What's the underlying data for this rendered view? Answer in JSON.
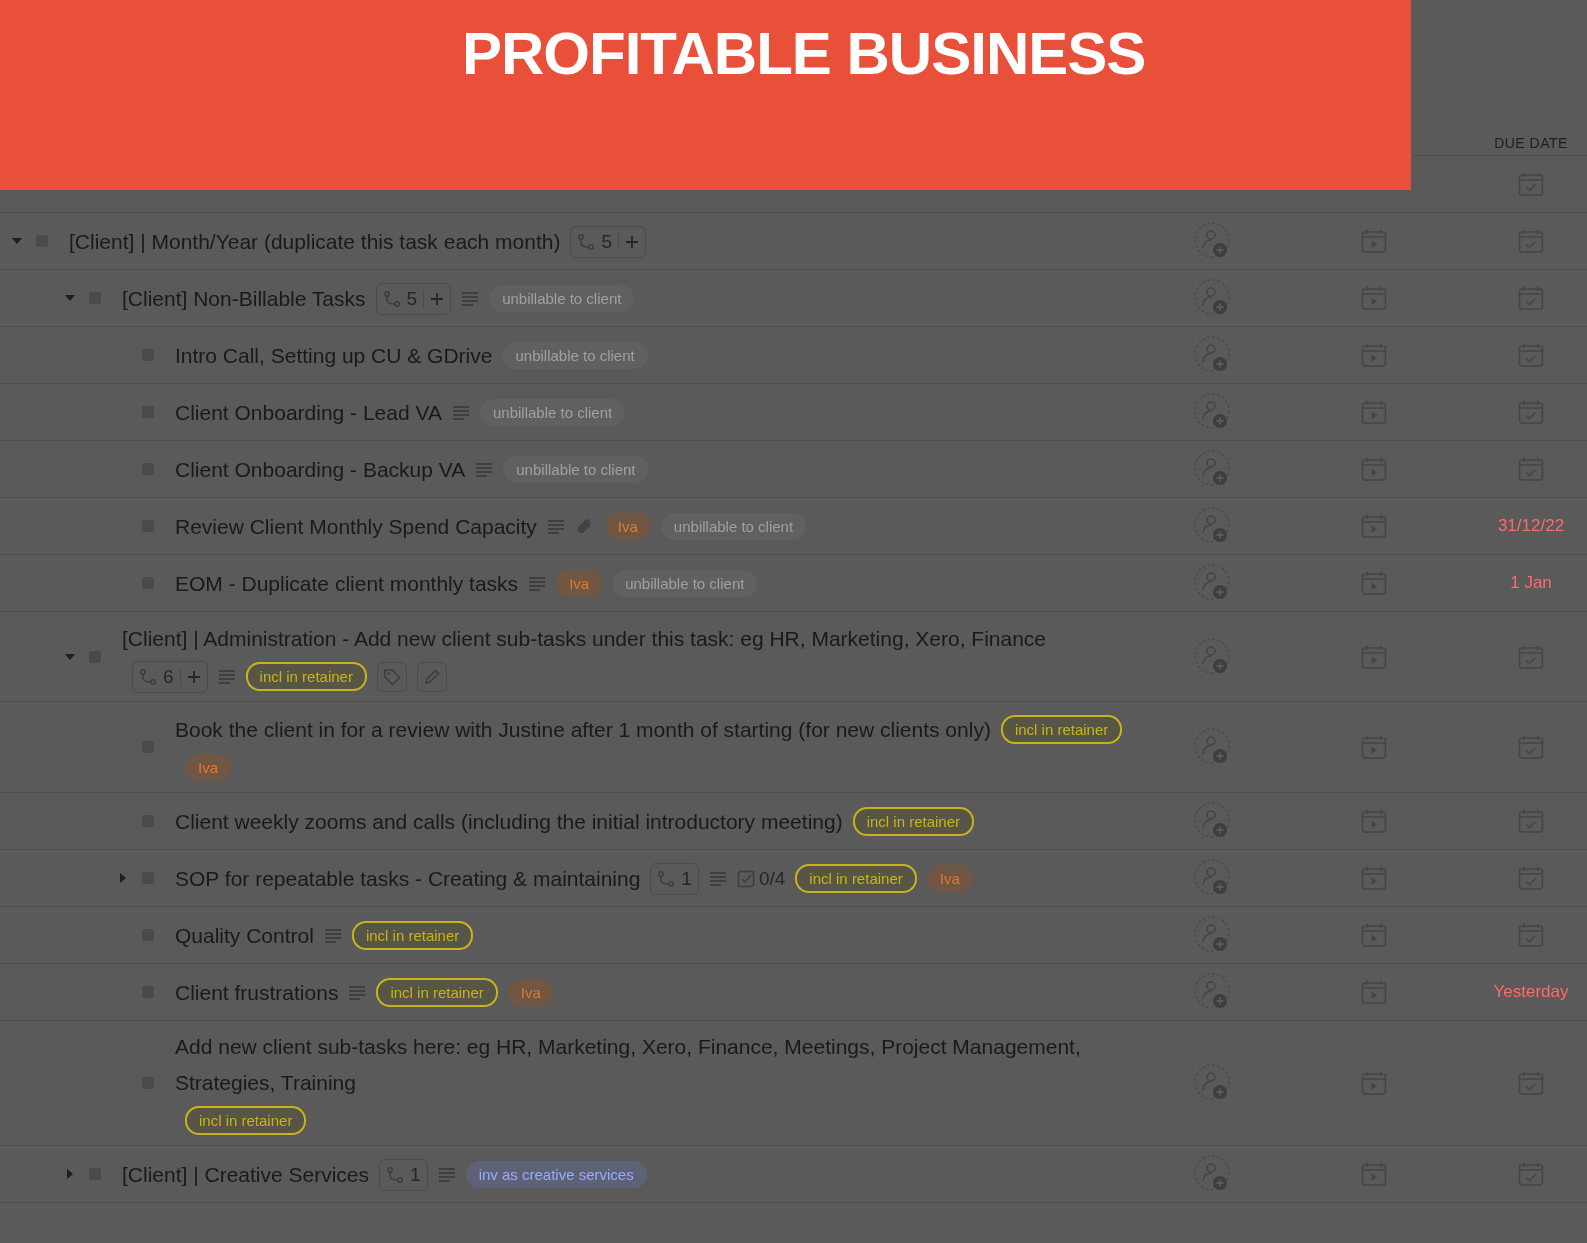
{
  "banner": {
    "title": "PROFITABLE BUSINESS"
  },
  "columns": {
    "due_date": "DUE DATE"
  },
  "tasks": [
    {
      "name": "[Client] | Month/Year (duplicate this task each month)",
      "checked": false,
      "expanded": true,
      "items": [
        {
          "kind": "subtasks",
          "count": "5"
        }
      ],
      "children": [
        {
          "name": "[Client] Non-Billable Tasks",
          "checked": false,
          "expanded": true,
          "items": [
            {
              "kind": "subtasks",
              "count": "5"
            },
            {
              "kind": "description"
            },
            {
              "kind": "tag",
              "label": "unbillable to client",
              "color": "#a0a0a0"
            }
          ],
          "children": [
            {
              "name": "Intro Call, Setting up CU & GDrive",
              "checked": false,
              "items": [
                {
                  "kind": "tag",
                  "label": "unbillable to client",
                  "color": "#a0a0a0"
                }
              ]
            },
            {
              "name": "Client Onboarding - Lead VA",
              "checked": false,
              "items": [
                {
                  "kind": "description"
                },
                {
                  "kind": "tag",
                  "label": "unbillable to client",
                  "color": "#a0a0a0"
                }
              ]
            },
            {
              "name": "Client Onboarding - Backup VA",
              "checked": false,
              "items": [
                {
                  "kind": "description"
                },
                {
                  "kind": "tag",
                  "label": "unbillable to client",
                  "color": "#a0a0a0"
                }
              ]
            },
            {
              "name": "Review Client Monthly Spend Capacity",
              "checked": false,
              "items": [
                {
                  "kind": "description"
                },
                {
                  "kind": "attachment"
                },
                {
                  "kind": "tag",
                  "label": "Iva",
                  "color": "#e07a2c"
                },
                {
                  "kind": "tag",
                  "label": "unbillable to client",
                  "color": "#a0a0a0"
                }
              ],
              "due": "31/12/22"
            },
            {
              "name": "EOM - Duplicate client monthly tasks",
              "checked": false,
              "items": [
                {
                  "kind": "description"
                },
                {
                  "kind": "tag",
                  "label": "Iva",
                  "color": "#e07a2c"
                },
                {
                  "kind": "tag",
                  "label": "unbillable to client",
                  "color": "#a0a0a0"
                }
              ],
              "due": "1 Jan"
            }
          ]
        },
        {
          "name": "[Client] | Administration - Add new client sub-tasks under this task: eg HR, Marketing, Xero, Finance",
          "checked": false,
          "expanded": true,
          "items": [
            {
              "kind": "subtasks",
              "count": "6"
            },
            {
              "kind": "description"
            },
            {
              "kind": "outlined_tag",
              "label": "incl in retainer",
              "color": "#c8b41a"
            },
            {
              "kind": "tag_button"
            },
            {
              "kind": "edit_button"
            }
          ],
          "children": [
            {
              "name": "Book the client in for a review with Justine after 1 month of starting (for new clients only)",
              "checked": false,
              "items": [
                {
                  "kind": "outlined_tag",
                  "label": "incl in retainer",
                  "color": "#c8b41a"
                },
                {
                  "kind": "tag",
                  "label": "Iva",
                  "color": "#e07a2c"
                }
              ]
            },
            {
              "name": "Client weekly zooms and calls (including the initial introductory meeting)",
              "checked": false,
              "items": [
                {
                  "kind": "outlined_tag",
                  "label": "incl in retainer",
                  "color": "#c8b41a"
                }
              ]
            },
            {
              "name": "SOP for repeatable tasks - Creating & maintaining",
              "checked": false,
              "expanded": false,
              "items": [
                {
                  "kind": "subtasks",
                  "count": "1",
                  "addable": false
                },
                {
                  "kind": "description"
                },
                {
                  "kind": "checklist",
                  "text": "0/4"
                },
                {
                  "kind": "outlined_tag",
                  "label": "incl in retainer",
                  "color": "#c8b41a"
                },
                {
                  "kind": "tag",
                  "label": "Iva",
                  "color": "#e07a2c"
                }
              ]
            },
            {
              "name": "Quality Control",
              "checked": false,
              "items": [
                {
                  "kind": "description"
                },
                {
                  "kind": "outlined_tag",
                  "label": "incl in retainer",
                  "color": "#c8b41a"
                }
              ]
            },
            {
              "name": "Client frustrations",
              "checked": false,
              "items": [
                {
                  "kind": "description"
                },
                {
                  "kind": "outlined_tag",
                  "label": "incl in retainer",
                  "color": "#c8b41a"
                },
                {
                  "kind": "tag",
                  "label": "Iva",
                  "color": "#e07a2c"
                }
              ],
              "due": "Yesterday"
            },
            {
              "name": "Add new client sub-tasks here: eg HR, Marketing, Xero, Finance, Meetings, Project Management, Strategies, Training",
              "checked": false,
              "items": [
                {
                  "kind": "outlined_tag",
                  "label": "incl in retainer",
                  "color": "#c8b41a"
                }
              ]
            }
          ]
        },
        {
          "name": "[Client] | Creative Services",
          "checked": false,
          "expanded": false,
          "items": [
            {
              "kind": "subtasks",
              "count": "1",
              "addable": false
            },
            {
              "kind": "description"
            },
            {
              "kind": "tag",
              "label": "inv as creative services",
              "color": "#9aaaff"
            }
          ]
        }
      ]
    }
  ]
}
